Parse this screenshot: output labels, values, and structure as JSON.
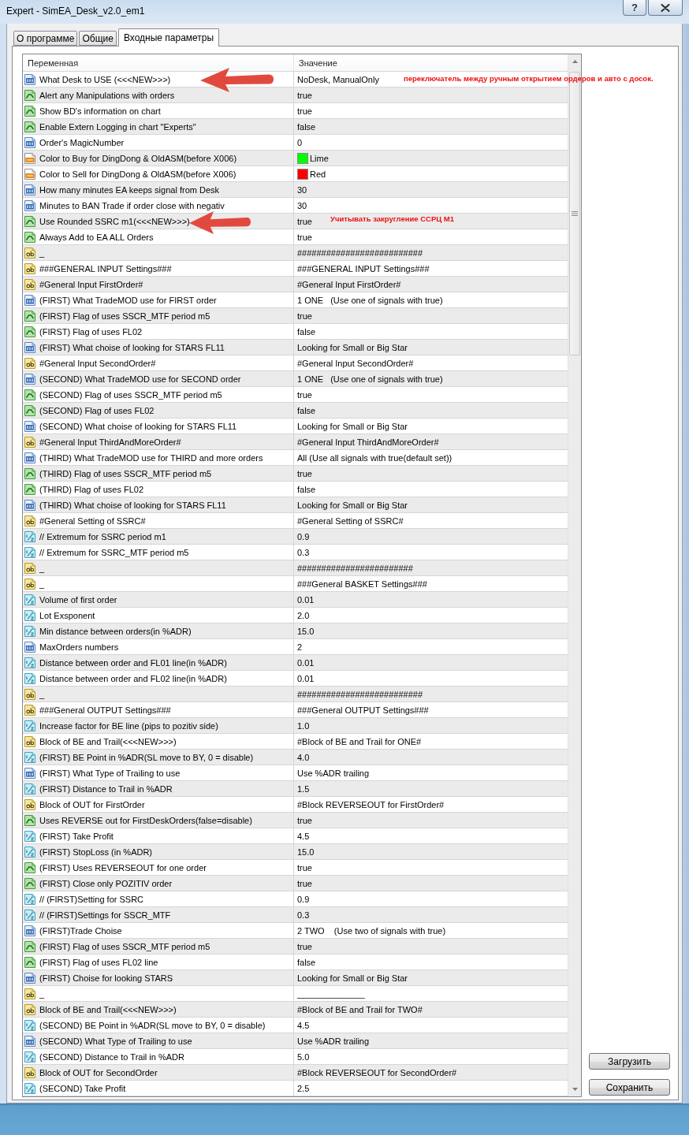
{
  "window": {
    "title": "Expert - SimEA_Desk_v2.0_em1",
    "help_button": "?"
  },
  "tabs": [
    {
      "label": "О программе",
      "selected": false
    },
    {
      "label": "Общие",
      "selected": false
    },
    {
      "label": "Входные параметры",
      "selected": true
    }
  ],
  "table": {
    "columns": [
      "Переменная",
      "Значение"
    ],
    "rows": [
      {
        "kind": "int",
        "variable": "What Desk to USE (<<<NEW>>>)",
        "value": "NoDesk, ManualOnly",
        "note": "переключатель между ручным открытием ордеров и авто с досок."
      },
      {
        "kind": "bool",
        "variable": "Alert any Manipulations with orders",
        "value": "true"
      },
      {
        "kind": "bool",
        "variable": "Show BD's information on chart",
        "value": "true"
      },
      {
        "kind": "bool",
        "variable": "Enable Extern Logging in chart \"Experts\"",
        "value": "false"
      },
      {
        "kind": "int",
        "variable": "Order's MagicNumber",
        "value": "0"
      },
      {
        "kind": "color",
        "variable": "Color to Buy for DingDong & OldASM(before X006)",
        "value": "Lime",
        "color": "#00ff00"
      },
      {
        "kind": "color",
        "variable": "Color to Sell for DingDong & OldASM(before X006)",
        "value": "Red",
        "color": "#ff0000"
      },
      {
        "kind": "int",
        "variable": "How many minutes EA keeps signal from Desk",
        "value": "30"
      },
      {
        "kind": "int",
        "variable": "Minutes to BAN Trade if order close with negativ",
        "value": "30"
      },
      {
        "kind": "bool",
        "variable": "Use Rounded SSRC m1(<<<NEW>>>)",
        "value": "true",
        "note": "Учитывать закругление ССРЦ М1"
      },
      {
        "kind": "bool",
        "variable": "Always Add to EA ALL Orders",
        "value": "true"
      },
      {
        "kind": "string",
        "variable": "_",
        "value": "##########################"
      },
      {
        "kind": "string",
        "variable": "###GENERAL INPUT Settings###",
        "value": "###GENERAL INPUT Settings###"
      },
      {
        "kind": "string",
        "variable": "#General Input FirstOrder#",
        "value": "#General Input FirstOrder#"
      },
      {
        "kind": "int",
        "variable": "(FIRST) What TradeMOD use for FIRST order",
        "value": "1 ONE   (Use one of signals with true)"
      },
      {
        "kind": "bool",
        "variable": "(FIRST) Flag of uses SSCR_MTF period m5",
        "value": "true"
      },
      {
        "kind": "bool",
        "variable": "(FIRST) Flag of uses FL02",
        "value": "false"
      },
      {
        "kind": "int",
        "variable": "(FIRST) What choise of looking for STARS FL11",
        "value": "Looking for Small or Big Star"
      },
      {
        "kind": "string",
        "variable": "#General Input SecondOrder#",
        "value": "#General Input SecondOrder#"
      },
      {
        "kind": "int",
        "variable": "(SECOND) What TradeMOD use for SECOND order",
        "value": "1 ONE   (Use one of signals with true)"
      },
      {
        "kind": "bool",
        "variable": "(SECOND) Flag of uses SSCR_MTF period m5",
        "value": "true"
      },
      {
        "kind": "bool",
        "variable": "(SECOND) Flag of uses FL02",
        "value": "false"
      },
      {
        "kind": "int",
        "variable": "(SECOND) What choise of looking for STARS FL11",
        "value": "Looking for Small or Big Star"
      },
      {
        "kind": "string",
        "variable": "#General Input ThirdAndMoreOrder#",
        "value": "#General Input ThirdAndMoreOrder#"
      },
      {
        "kind": "int",
        "variable": "(THIRD) What TradeMOD use for THIRD and more orders",
        "value": "All (Use all signals with true(default set))"
      },
      {
        "kind": "bool",
        "variable": "(THIRD) Flag of uses SSCR_MTF period m5",
        "value": "true"
      },
      {
        "kind": "bool",
        "variable": "(THIRD) Flag of uses FL02",
        "value": "false"
      },
      {
        "kind": "int",
        "variable": "(THIRD) What choise of looking for STARS FL11",
        "value": "Looking for Small or Big Star"
      },
      {
        "kind": "string",
        "variable": "#General Setting of SSRC#",
        "value": "#General Setting of SSRC#"
      },
      {
        "kind": "double",
        "variable": "// Extremum for SSRC period m1",
        "value": "0.9"
      },
      {
        "kind": "double",
        "variable": "// Extremum for SSRC_MTF period m5",
        "value": "0.3"
      },
      {
        "kind": "string",
        "variable": "_",
        "value": "########################"
      },
      {
        "kind": "string",
        "variable": "_",
        "value": "###General BASKET Settings###"
      },
      {
        "kind": "double",
        "variable": "Volume of first order",
        "value": "0.01"
      },
      {
        "kind": "double",
        "variable": "Lot Exsponent",
        "value": "2.0"
      },
      {
        "kind": "double",
        "variable": "Min distance between orders(in %ADR)",
        "value": "15.0"
      },
      {
        "kind": "int",
        "variable": "MaxOrders numbers",
        "value": "2"
      },
      {
        "kind": "double",
        "variable": "Distance between order and FL01 line(in %ADR)",
        "value": "0.01"
      },
      {
        "kind": "double",
        "variable": "Distance between order and FL02 line(in %ADR)",
        "value": "0.01"
      },
      {
        "kind": "string",
        "variable": "_",
        "value": "##########################"
      },
      {
        "kind": "string",
        "variable": "###General OUTPUT Settings###",
        "value": "###General OUTPUT Settings###"
      },
      {
        "kind": "double",
        "variable": "Increase factor for BE line (pips to pozitiv side)",
        "value": "1.0"
      },
      {
        "kind": "string",
        "variable": "Block of BE and Trail(<<<NEW>>>)",
        "value": "#Block of BE and Trail for ONE#"
      },
      {
        "kind": "double",
        "variable": "(FIRST) BE Point in %ADR(SL move to BY, 0 = disable)",
        "value": "4.0"
      },
      {
        "kind": "int",
        "variable": "(FIRST) What Type of Trailing to use",
        "value": "Use %ADR trailing"
      },
      {
        "kind": "double",
        "variable": "(FIRST) Distance to Trail in %ADR",
        "value": "1.5"
      },
      {
        "kind": "string",
        "variable": "Block of OUT for FirstOrder",
        "value": "#Block REVERSEOUT for FirstOrder#"
      },
      {
        "kind": "bool",
        "variable": "Uses REVERSE out for FirstDeskOrders(false=disable)",
        "value": "true"
      },
      {
        "kind": "double",
        "variable": "(FIRST) Take Profit",
        "value": "4.5"
      },
      {
        "kind": "double",
        "variable": "(FIRST) StopLoss (in %ADR)",
        "value": "15.0"
      },
      {
        "kind": "bool",
        "variable": "(FIRST) Uses REVERSEOUT for one order",
        "value": "true"
      },
      {
        "kind": "bool",
        "variable": "(FIRST) Close only POZITIV order",
        "value": "true"
      },
      {
        "kind": "double",
        "variable": "// (FIRST)Setting for SSRC",
        "value": "0.9"
      },
      {
        "kind": "double",
        "variable": "// (FIRST)Settings for SSCR_MTF",
        "value": "0.3"
      },
      {
        "kind": "int",
        "variable": "(FIRST)Trade Choise",
        "value": "2 TWO    (Use two of signals with true)"
      },
      {
        "kind": "bool",
        "variable": "(FIRST) Flag of uses SSCR_MTF period m5",
        "value": "true"
      },
      {
        "kind": "bool",
        "variable": "(FIRST) Flag of uses FL02 line",
        "value": "false"
      },
      {
        "kind": "int",
        "variable": "(FIRST) Choise for looking STARS",
        "value": "Looking for Small or Big Star"
      },
      {
        "kind": "string",
        "variable": "_",
        "value": "______________"
      },
      {
        "kind": "string",
        "variable": "Block of BE and Trail(<<<NEW>>>)",
        "value": "#Block of BE and Trail for TWO#"
      },
      {
        "kind": "double",
        "variable": "(SECOND) BE Point in %ADR(SL move to BY, 0 = disable)",
        "value": "4.5"
      },
      {
        "kind": "int",
        "variable": "(SECOND) What Type of Trailing to use",
        "value": "Use %ADR trailing"
      },
      {
        "kind": "double",
        "variable": "(SECOND) Distance to Trail in %ADR",
        "value": "5.0"
      },
      {
        "kind": "string",
        "variable": "Block of OUT for SecondOrder",
        "value": "#Block REVERSEOUT for SecondOrder#"
      },
      {
        "kind": "double",
        "variable": "(SECOND) Take Profit",
        "value": "2.5"
      }
    ]
  },
  "buttons": [
    "Загрузить",
    "Сохранить"
  ]
}
